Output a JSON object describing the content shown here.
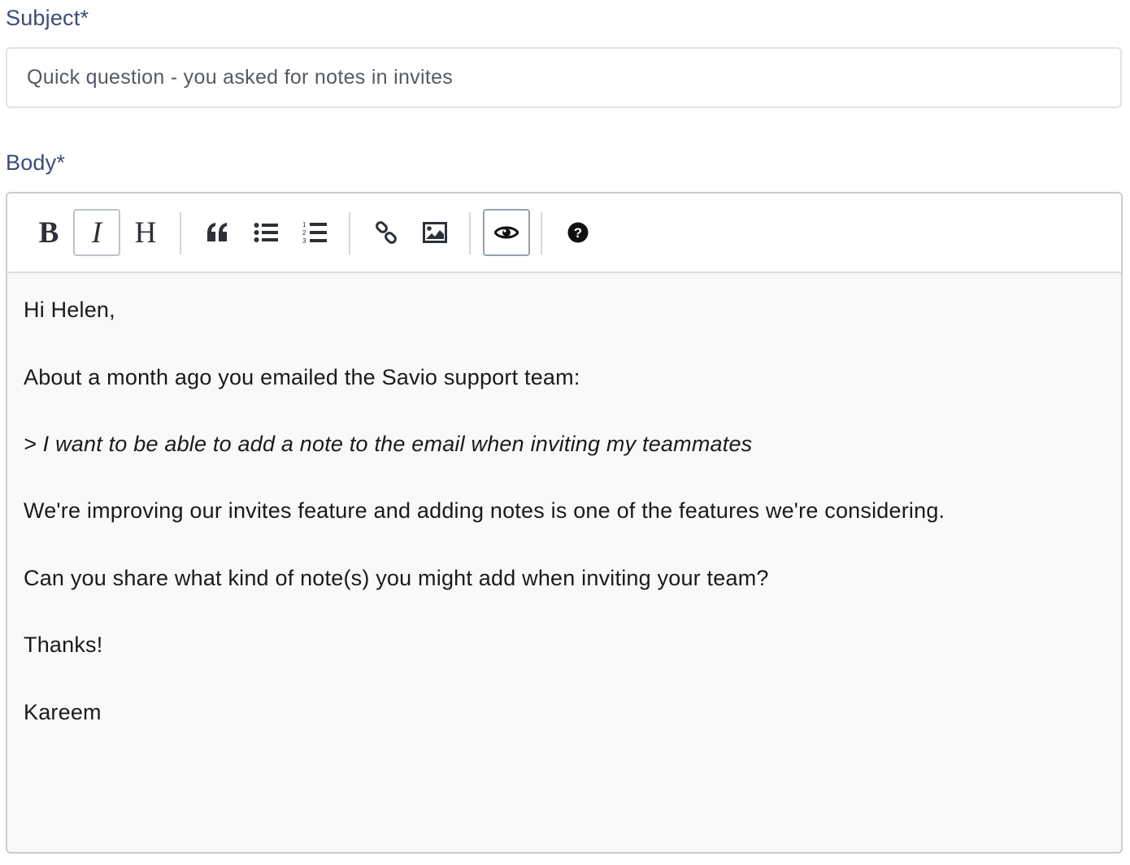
{
  "subject": {
    "label": "Subject*",
    "value": "Quick question - you asked for notes in invites"
  },
  "body": {
    "label": "Body*",
    "toolbar": {
      "bold_label": "B",
      "italic_label": "I",
      "heading_label": "H",
      "icons": [
        "bold-icon",
        "italic-icon",
        "heading-icon",
        "quote-icon",
        "unordered-list-icon",
        "ordered-list-icon",
        "link-icon",
        "image-icon",
        "preview-eye-icon",
        "help-icon"
      ],
      "active": [
        "preview"
      ]
    },
    "lines": [
      "Hi Helen,",
      "About a month ago you emailed the Savio support team:",
      "> I want to be able to add a note to the email when inviting my teammates",
      "We're improving our invites feature and adding notes is one of the features we're considering.",
      "Can you share what kind of note(s) you might add when inviting your team?",
      "Thanks!",
      "Kareem"
    ]
  },
  "colors": {
    "label": "#3d4b78",
    "input_border": "#dfe3e8",
    "editor_bg": "#f9f9f9",
    "text": "#1a1a1a"
  }
}
